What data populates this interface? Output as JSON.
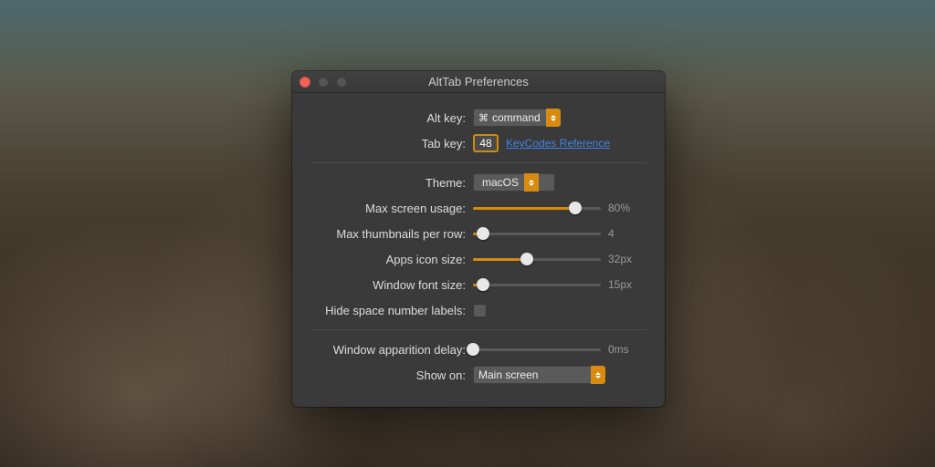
{
  "window": {
    "title": "AltTab Preferences"
  },
  "rows": {
    "altkey": {
      "label": "Alt key:",
      "value": "command",
      "glyph": "⌘"
    },
    "tabkey": {
      "label": "Tab key:",
      "value": "48",
      "link": "KeyCodes Reference"
    },
    "theme": {
      "label": "Theme:",
      "value": "macOS",
      "glyph": ""
    },
    "maxscreen": {
      "label": "Max screen usage:",
      "pct": 80,
      "text": "80%"
    },
    "maxthumbs": {
      "label": "Max thumbnails per row:",
      "pct": 8,
      "text": "4"
    },
    "iconsize": {
      "label": "Apps icon size:",
      "pct": 42,
      "text": "32px"
    },
    "fontsize": {
      "label": "Window font size:",
      "pct": 8,
      "text": "15px"
    },
    "hidespace": {
      "label": "Hide space number labels:"
    },
    "appdelay": {
      "label": "Window apparition delay:",
      "pct": 0,
      "text": "0ms"
    },
    "showon": {
      "label": "Show on:",
      "value": "Main screen"
    }
  }
}
